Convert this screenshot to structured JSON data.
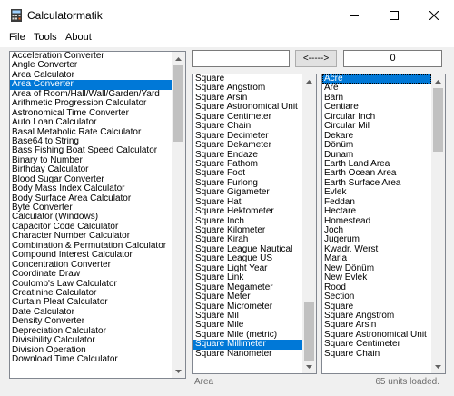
{
  "window": {
    "title": "Calculatormatik"
  },
  "menu": [
    "File",
    "Tools",
    "About"
  ],
  "converters": {
    "selected_index": 3,
    "scroll_position": 0.0,
    "items": [
      "Acceleration Converter",
      "Angle Converter",
      "Area Calculator",
      "Area Converter",
      "Area of Room/Hall/Wall/Garden/Yard",
      "Arithmetic Progression Calculator",
      "Astronomical Time Converter",
      "Auto Loan Calculator",
      "Basal Metabolic Rate Calculator",
      "Base64 to String",
      "Bass Fishing Boat Speed Calculator",
      "Binary to Number",
      "Birthday Calculator",
      "Blood Sugar Converter",
      "Body Mass Index Calculator",
      "Body Surface Area Calculator",
      "Byte Converter",
      "Calculator (Windows)",
      "Capacitor Code Calculator",
      "Character Number Calculator",
      "Combination & Permutation Calculator",
      "Compound Interest Calculator",
      "Concentration Converter",
      "Coordinate Draw",
      "Coulomb's Law Calculator",
      "Creatinine Calculator",
      "Curtain Pleat Calculator",
      "Date Calculator",
      "Density Converter",
      "Depreciation Calculator",
      "Divisibility Calculator",
      "Division Operation",
      "Download Time Calculator"
    ]
  },
  "converter": {
    "input_value": "",
    "swap_label": "<----->",
    "output_value": "0"
  },
  "from_units": {
    "selected_index": 28,
    "scroll_position": 0.74,
    "items": [
      "Square",
      "Square Angstrom",
      "Square Arsin",
      "Square Astronomical Unit",
      "Square Centimeter",
      "Square Chain",
      "Square Decimeter",
      "Square Dekameter",
      "Square Endaze",
      "Square Fathom",
      "Square Foot",
      "Square Furlong",
      "Square Gigameter",
      "Square Hat",
      "Square Hektometer",
      "Square Inch",
      "Square Kilometer",
      "Square Kirah",
      "Square League Nautical",
      "Square League US",
      "Square Light Year",
      "Square Link",
      "Square Megameter",
      "Square Meter",
      "Square Micrometer",
      "Square Mil",
      "Square Mile",
      "Square Mile (metric)",
      "Square Millimeter",
      "Square Nanometer"
    ]
  },
  "to_units": {
    "selected_index": 0,
    "scroll_position": 0.0,
    "items": [
      "Acre",
      "Are",
      "Barn",
      "Centiare",
      "Circular Inch",
      "Circular Mil",
      "Dekare",
      "Dönüm",
      "Dunam",
      "Earth Land Area",
      "Earth Ocean Area",
      "Earth Surface Area",
      "Evlek",
      "Feddan",
      "Hectare",
      "Homestead",
      "Joch",
      "Jugerum",
      "Kwadr. Werst",
      "Marla",
      "New Dönüm",
      "New Evlek",
      "Rood",
      "Section",
      "Square",
      "Square Angstrom",
      "Square Arsin",
      "Square Astronomical Unit",
      "Square Centimeter",
      "Square Chain"
    ]
  },
  "status": {
    "category": "Area",
    "units_loaded": "65 units loaded."
  }
}
